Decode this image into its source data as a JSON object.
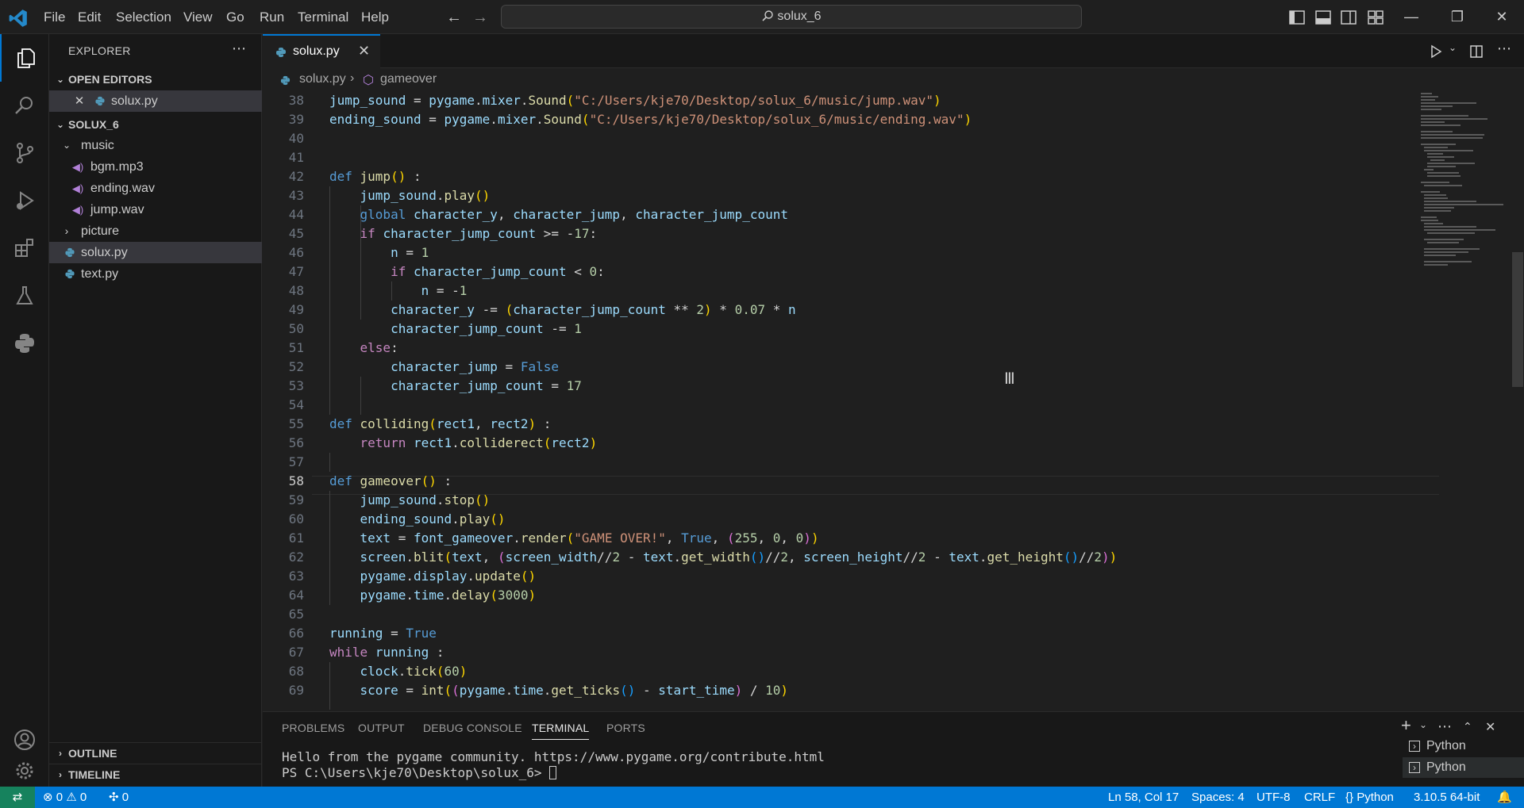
{
  "titlebar": {
    "menu": [
      "File",
      "Edit",
      "Selection",
      "View",
      "Go",
      "Run",
      "Terminal",
      "Help"
    ],
    "command_center": "solux_6"
  },
  "sidebar": {
    "title": "EXPLORER",
    "open_editors_label": "OPEN EDITORS",
    "open_editors": [
      "solux.py"
    ],
    "project_label": "SOLUX_6",
    "tree": [
      {
        "label": "music",
        "kind": "folder-open"
      },
      {
        "label": "bgm.mp3",
        "kind": "audio"
      },
      {
        "label": "ending.wav",
        "kind": "audio"
      },
      {
        "label": "jump.wav",
        "kind": "audio"
      },
      {
        "label": "picture",
        "kind": "folder-closed"
      },
      {
        "label": "solux.py",
        "kind": "python",
        "selected": true
      },
      {
        "label": "text.py",
        "kind": "python"
      }
    ],
    "outline_label": "OUTLINE",
    "timeline_label": "TIMELINE"
  },
  "editor": {
    "tab_label": "solux.py",
    "breadcrumb": [
      "solux.py",
      "gameover"
    ],
    "current_line": 58,
    "lines": [
      {
        "n": "38",
        "tokens": [
          [
            "var",
            "jump_sound"
          ],
          [
            "op",
            " = "
          ],
          [
            "var",
            "pygame"
          ],
          [
            "op",
            "."
          ],
          [
            "var",
            "mixer"
          ],
          [
            "op",
            "."
          ],
          [
            "fn",
            "Sound"
          ],
          [
            "b1",
            "("
          ],
          [
            "str",
            "\"C:/Users/kje70/Desktop/solux_6/music/jump.wav\""
          ],
          [
            "b1",
            ")"
          ]
        ]
      },
      {
        "n": "39",
        "tokens": [
          [
            "var",
            "ending_sound"
          ],
          [
            "op",
            " = "
          ],
          [
            "var",
            "pygame"
          ],
          [
            "op",
            "."
          ],
          [
            "var",
            "mixer"
          ],
          [
            "op",
            "."
          ],
          [
            "fn",
            "Sound"
          ],
          [
            "b1",
            "("
          ],
          [
            "str",
            "\"C:/Users/kje70/Desktop/solux_6/music/ending.wav\""
          ],
          [
            "b1",
            ")"
          ]
        ]
      },
      {
        "n": "40",
        "tokens": []
      },
      {
        "n": "41",
        "tokens": []
      },
      {
        "n": "42",
        "tokens": [
          [
            "kw",
            "def "
          ],
          [
            "fn",
            "jump"
          ],
          [
            "b1",
            "()"
          ],
          [
            "op",
            " :"
          ]
        ]
      },
      {
        "n": "43",
        "tokens": [
          [
            "op",
            "    "
          ],
          [
            "var",
            "jump_sound"
          ],
          [
            "op",
            "."
          ],
          [
            "fn",
            "play"
          ],
          [
            "b1",
            "()"
          ]
        ]
      },
      {
        "n": "44",
        "tokens": [
          [
            "op",
            "    "
          ],
          [
            "kw",
            "global "
          ],
          [
            "var",
            "character_y"
          ],
          [
            "op",
            ", "
          ],
          [
            "var",
            "character_jump"
          ],
          [
            "op",
            ", "
          ],
          [
            "var",
            "character_jump_count"
          ]
        ]
      },
      {
        "n": "45",
        "tokens": [
          [
            "op",
            "    "
          ],
          [
            "ctl",
            "if "
          ],
          [
            "var",
            "character_jump_count"
          ],
          [
            "op",
            " >= -"
          ],
          [
            "num",
            "17"
          ],
          [
            "op",
            ":"
          ]
        ]
      },
      {
        "n": "46",
        "tokens": [
          [
            "op",
            "        "
          ],
          [
            "var",
            "n"
          ],
          [
            "op",
            " = "
          ],
          [
            "num",
            "1"
          ]
        ]
      },
      {
        "n": "47",
        "tokens": [
          [
            "op",
            "        "
          ],
          [
            "ctl",
            "if "
          ],
          [
            "var",
            "character_jump_count"
          ],
          [
            "op",
            " < "
          ],
          [
            "num",
            "0"
          ],
          [
            "op",
            ":"
          ]
        ]
      },
      {
        "n": "48",
        "tokens": [
          [
            "op",
            "            "
          ],
          [
            "var",
            "n"
          ],
          [
            "op",
            " = -"
          ],
          [
            "num",
            "1"
          ]
        ]
      },
      {
        "n": "49",
        "tokens": [
          [
            "op",
            "        "
          ],
          [
            "var",
            "character_y"
          ],
          [
            "op",
            " -= "
          ],
          [
            "b1",
            "("
          ],
          [
            "var",
            "character_jump_count"
          ],
          [
            "op",
            " ** "
          ],
          [
            "num",
            "2"
          ],
          [
            "b1",
            ")"
          ],
          [
            "op",
            " * "
          ],
          [
            "num",
            "0.07"
          ],
          [
            "op",
            " * "
          ],
          [
            "var",
            "n"
          ]
        ]
      },
      {
        "n": "50",
        "tokens": [
          [
            "op",
            "        "
          ],
          [
            "var",
            "character_jump_count"
          ],
          [
            "op",
            " -= "
          ],
          [
            "num",
            "1"
          ]
        ]
      },
      {
        "n": "51",
        "tokens": [
          [
            "op",
            "    "
          ],
          [
            "ctl",
            "else"
          ],
          [
            "op",
            ":"
          ]
        ]
      },
      {
        "n": "52",
        "tokens": [
          [
            "op",
            "        "
          ],
          [
            "var",
            "character_jump"
          ],
          [
            "op",
            " = "
          ],
          [
            "kw",
            "False"
          ]
        ]
      },
      {
        "n": "53",
        "tokens": [
          [
            "op",
            "        "
          ],
          [
            "var",
            "character_jump_count"
          ],
          [
            "op",
            " = "
          ],
          [
            "num",
            "17"
          ]
        ]
      },
      {
        "n": "54",
        "tokens": []
      },
      {
        "n": "55",
        "tokens": [
          [
            "kw",
            "def "
          ],
          [
            "fn",
            "colliding"
          ],
          [
            "b1",
            "("
          ],
          [
            "var",
            "rect1"
          ],
          [
            "op",
            ", "
          ],
          [
            "var",
            "rect2"
          ],
          [
            "b1",
            ")"
          ],
          [
            "op",
            " :"
          ]
        ]
      },
      {
        "n": "56",
        "tokens": [
          [
            "op",
            "    "
          ],
          [
            "ctl",
            "return "
          ],
          [
            "var",
            "rect1"
          ],
          [
            "op",
            "."
          ],
          [
            "fn",
            "colliderect"
          ],
          [
            "b1",
            "("
          ],
          [
            "var",
            "rect2"
          ],
          [
            "b1",
            ")"
          ]
        ]
      },
      {
        "n": "57",
        "tokens": []
      },
      {
        "n": "58",
        "tokens": [
          [
            "kw",
            "def "
          ],
          [
            "fn",
            "gameover"
          ],
          [
            "b1",
            "()"
          ],
          [
            "op",
            " :"
          ]
        ]
      },
      {
        "n": "59",
        "tokens": [
          [
            "op",
            "    "
          ],
          [
            "var",
            "jump_sound"
          ],
          [
            "op",
            "."
          ],
          [
            "fn",
            "stop"
          ],
          [
            "b1",
            "()"
          ]
        ]
      },
      {
        "n": "60",
        "tokens": [
          [
            "op",
            "    "
          ],
          [
            "var",
            "ending_sound"
          ],
          [
            "op",
            "."
          ],
          [
            "fn",
            "play"
          ],
          [
            "b1",
            "()"
          ]
        ]
      },
      {
        "n": "61",
        "tokens": [
          [
            "op",
            "    "
          ],
          [
            "var",
            "text"
          ],
          [
            "op",
            " = "
          ],
          [
            "var",
            "font_gameover"
          ],
          [
            "op",
            "."
          ],
          [
            "fn",
            "render"
          ],
          [
            "b1",
            "("
          ],
          [
            "str",
            "\"GAME OVER!\""
          ],
          [
            "op",
            ", "
          ],
          [
            "kw",
            "True"
          ],
          [
            "op",
            ", "
          ],
          [
            "b2",
            "("
          ],
          [
            "num",
            "255"
          ],
          [
            "op",
            ", "
          ],
          [
            "num",
            "0"
          ],
          [
            "op",
            ", "
          ],
          [
            "num",
            "0"
          ],
          [
            "b2",
            ")"
          ],
          [
            "b1",
            ")"
          ]
        ]
      },
      {
        "n": "62",
        "tokens": [
          [
            "op",
            "    "
          ],
          [
            "var",
            "screen"
          ],
          [
            "op",
            "."
          ],
          [
            "fn",
            "blit"
          ],
          [
            "b1",
            "("
          ],
          [
            "var",
            "text"
          ],
          [
            "op",
            ", "
          ],
          [
            "b2",
            "("
          ],
          [
            "var",
            "screen_width"
          ],
          [
            "op",
            "//"
          ],
          [
            "num",
            "2"
          ],
          [
            "op",
            " - "
          ],
          [
            "var",
            "text"
          ],
          [
            "op",
            "."
          ],
          [
            "fn",
            "get_width"
          ],
          [
            "b3",
            "()"
          ],
          [
            "op",
            "//"
          ],
          [
            "num",
            "2"
          ],
          [
            "op",
            ", "
          ],
          [
            "var",
            "screen_height"
          ],
          [
            "op",
            "//"
          ],
          [
            "num",
            "2"
          ],
          [
            "op",
            " - "
          ],
          [
            "var",
            "text"
          ],
          [
            "op",
            "."
          ],
          [
            "fn",
            "get_height"
          ],
          [
            "b3",
            "()"
          ],
          [
            "op",
            "//"
          ],
          [
            "num",
            "2"
          ],
          [
            "b2",
            ")"
          ],
          [
            "b1",
            ")"
          ]
        ]
      },
      {
        "n": "63",
        "tokens": [
          [
            "op",
            "    "
          ],
          [
            "var",
            "pygame"
          ],
          [
            "op",
            "."
          ],
          [
            "var",
            "display"
          ],
          [
            "op",
            "."
          ],
          [
            "fn",
            "update"
          ],
          [
            "b1",
            "()"
          ]
        ]
      },
      {
        "n": "64",
        "tokens": [
          [
            "op",
            "    "
          ],
          [
            "var",
            "pygame"
          ],
          [
            "op",
            "."
          ],
          [
            "var",
            "time"
          ],
          [
            "op",
            "."
          ],
          [
            "fn",
            "delay"
          ],
          [
            "b1",
            "("
          ],
          [
            "num",
            "3000"
          ],
          [
            "b1",
            ")"
          ]
        ]
      },
      {
        "n": "65",
        "tokens": []
      },
      {
        "n": "66",
        "tokens": [
          [
            "var",
            "running"
          ],
          [
            "op",
            " = "
          ],
          [
            "kw",
            "True"
          ]
        ]
      },
      {
        "n": "67",
        "tokens": [
          [
            "ctl",
            "while "
          ],
          [
            "var",
            "running"
          ],
          [
            "op",
            " :"
          ]
        ]
      },
      {
        "n": "68",
        "tokens": [
          [
            "op",
            "    "
          ],
          [
            "var",
            "clock"
          ],
          [
            "op",
            "."
          ],
          [
            "fn",
            "tick"
          ],
          [
            "b1",
            "("
          ],
          [
            "num",
            "60"
          ],
          [
            "b1",
            ")"
          ]
        ]
      },
      {
        "n": "69",
        "tokens": [
          [
            "op",
            "    "
          ],
          [
            "var",
            "score"
          ],
          [
            "op",
            " = "
          ],
          [
            "fn",
            "int"
          ],
          [
            "b1",
            "("
          ],
          [
            "b2",
            "("
          ],
          [
            "var",
            "pygame"
          ],
          [
            "op",
            "."
          ],
          [
            "var",
            "time"
          ],
          [
            "op",
            "."
          ],
          [
            "fn",
            "get_ticks"
          ],
          [
            "b3",
            "()"
          ],
          [
            "op",
            " - "
          ],
          [
            "var",
            "start_time"
          ],
          [
            "b2",
            ")"
          ],
          [
            "op",
            " / "
          ],
          [
            "num",
            "10"
          ],
          [
            "b1",
            ")"
          ]
        ]
      }
    ]
  },
  "panel": {
    "tabs": [
      "PROBLEMS",
      "OUTPUT",
      "DEBUG CONSOLE",
      "TERMINAL",
      "PORTS"
    ],
    "active_tab": "TERMINAL",
    "terminal_lines": [
      "Hello from the pygame community. https://www.pygame.org/contribute.html",
      "PS C:\\Users\\kje70\\Desktop\\solux_6> "
    ],
    "terminals": [
      "Python",
      "Python"
    ]
  },
  "statusbar": {
    "errors": "0",
    "warnings": "0",
    "ports": "0",
    "position": "Ln 58, Col 17",
    "indent": "Spaces: 4",
    "encoding": "UTF-8",
    "eol": "CRLF",
    "language": "Python",
    "interpreter": "3.10.5 64-bit"
  },
  "colors": {
    "accent": "#0078d4",
    "background": "#1f1f1f",
    "sidebar": "#181818"
  }
}
